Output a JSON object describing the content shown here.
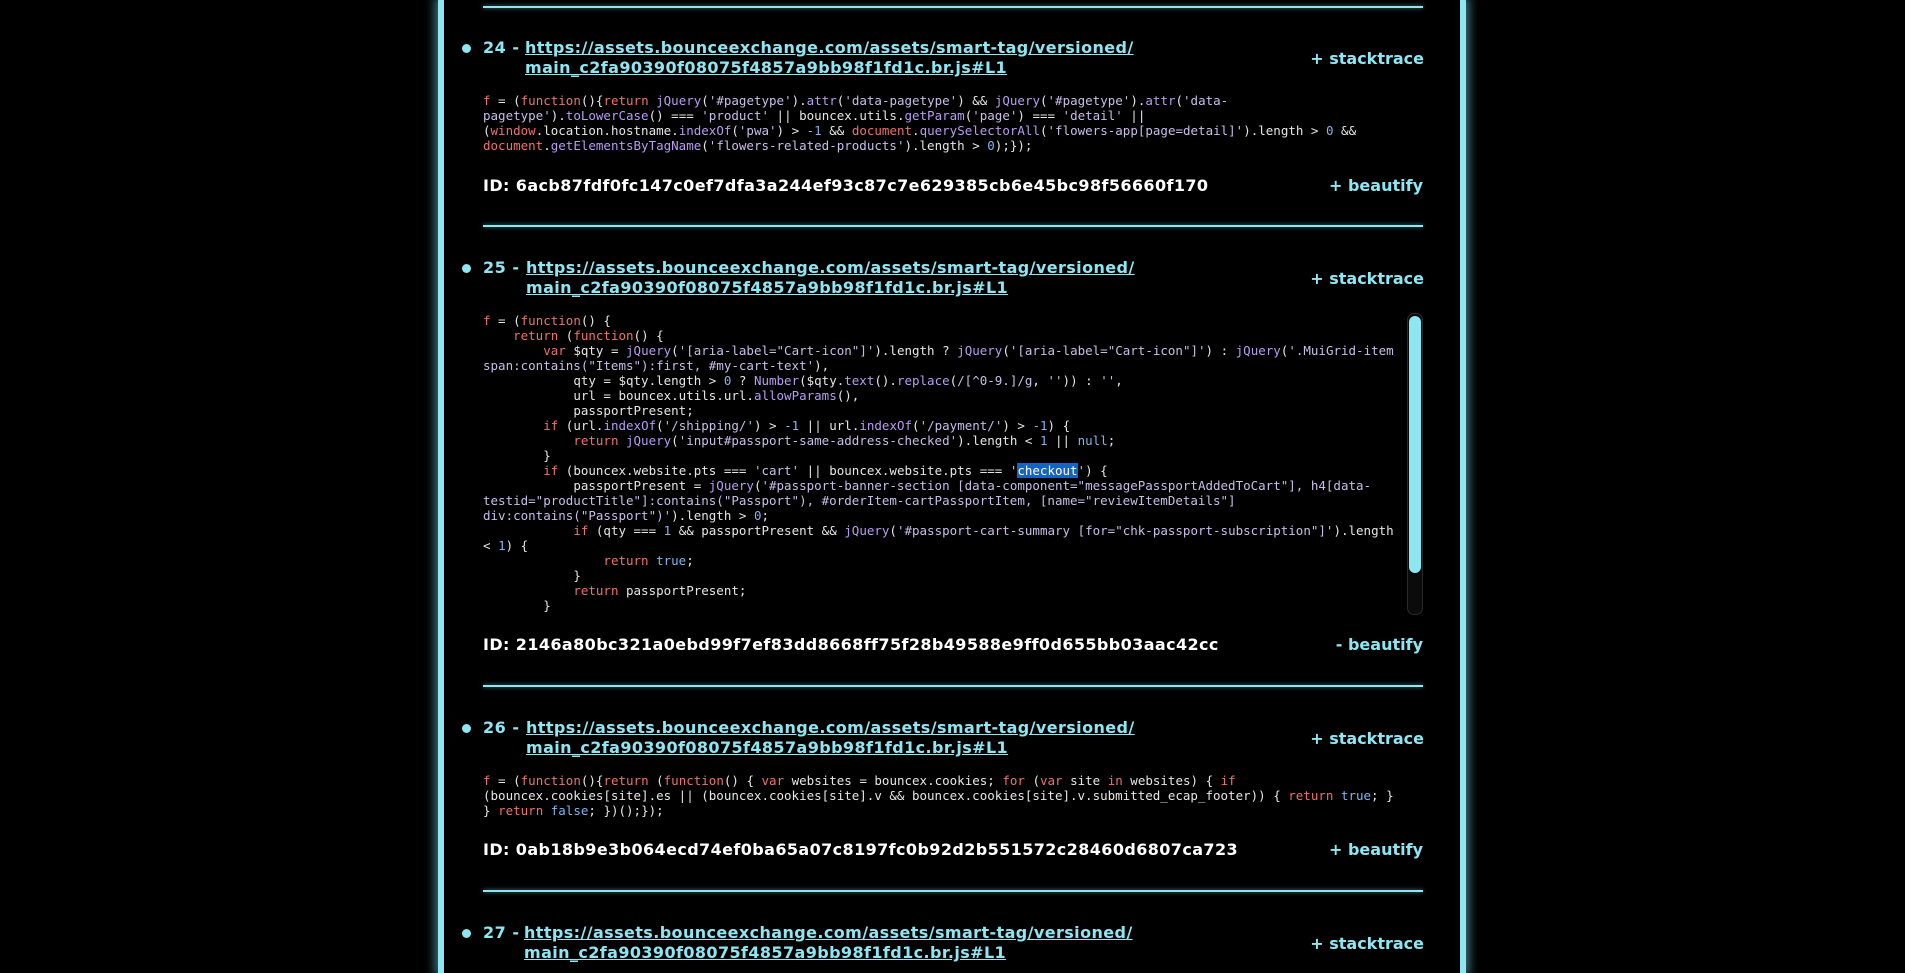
{
  "accent_color": "#8ee6f2",
  "entries": [
    {
      "num": "24 -",
      "url": "https://assets.bounceexchange.com/assets/smart-tag/versioned/main_c2fa90390f08075f4857a9bb98f1fd1c.br.js#L1",
      "stacktrace_label": "+ stacktrace",
      "id": "ID: 6acb87fdf0fc147c0ef7dfa3a244ef93c87c7e629385cb6e45bc98f56660f170",
      "beautify_label": "+ beautify",
      "code": "f = (function(){return jQuery('#pagetype').attr('data-pagetype') && jQuery('#pagetype').attr('data-pagetype').toLowerCase() === 'product' || bouncex.utils.getParam('page') === 'detail' || (window.location.hostname.indexOf('pwa') > -1 && document.querySelectorAll('flowers-app[page=detail]').length > 0 && document.getElementsByTagName('flowers-related-products').length > 0);});"
    },
    {
      "num": "25 -",
      "url": "https://assets.bounceexchange.com/assets/smart-tag/versioned/main_c2fa90390f08075f4857a9bb98f1fd1c.br.js#L1",
      "stacktrace_label": "+ stacktrace",
      "id": "ID: 2146a80bc321a0ebd99f7ef83dd8668ff75f28b49588e9ff0d655bb03aac42cc",
      "beautify_label": "- beautify",
      "highlight_word": "checkout",
      "code": "f = (function() {\n    return (function() {\n        var $qty = jQuery('[aria-label=\"Cart-icon\"]').length ? jQuery('[aria-label=\"Cart-icon\"]') : jQuery('.MuiGrid-item span:contains(\"Items\"):first, #my-cart-text'),\n            qty = $qty.length > 0 ? Number($qty.text().replace(/[^0-9.]/g, '')) : '',\n            url = bouncex.utils.url.allowParams(),\n            passportPresent;\n        if (url.indexOf('/shipping/') > -1 || url.indexOf('/payment/') > -1) {\n            return jQuery('input#passport-same-address-checked').length < 1 || null;\n        }\n        if (bouncex.website.pts === 'cart' || bouncex.website.pts === 'checkout') {\n            passportPresent = jQuery('#passport-banner-section [data-component=\"messagePassportAddedToCart\"], h4[data-testid=\"productTitle\"]:contains(\"Passport\"), #orderItem-cartPassportItem, [name=\"reviewItemDetails\"] div:contains(\"Passport\")').length > 0;\n            if (qty === 1 && passportPresent && jQuery('#passport-cart-summary [for=\"chk-passport-subscription\"]').length < 1) {\n                return true;\n            }\n            return passportPresent;\n        }"
    },
    {
      "num": "26 -",
      "url": "https://assets.bounceexchange.com/assets/smart-tag/versioned/main_c2fa90390f08075f4857a9bb98f1fd1c.br.js#L1",
      "stacktrace_label": "+ stacktrace",
      "id": "ID: 0ab18b9e3b064ecd74ef0ba65a07c8197fc0b92d2b551572c28460d6807ca723",
      "beautify_label": "+ beautify",
      "code": "f = (function(){return (function() { var websites = bouncex.cookies; for (var site in websites) { if (bouncex.cookies[site].es || (bouncex.cookies[site].v && bouncex.cookies[site].v.submitted_ecap_footer)) { return true; } } return false; })();});"
    },
    {
      "num": "27 -",
      "url": "https://assets.bounceexchange.com/assets/smart-tag/versioned/main_c2fa90390f08075f4857a9bb98f1fd1c.br.js#L1",
      "stacktrace_label": "+ stacktrace"
    }
  ]
}
